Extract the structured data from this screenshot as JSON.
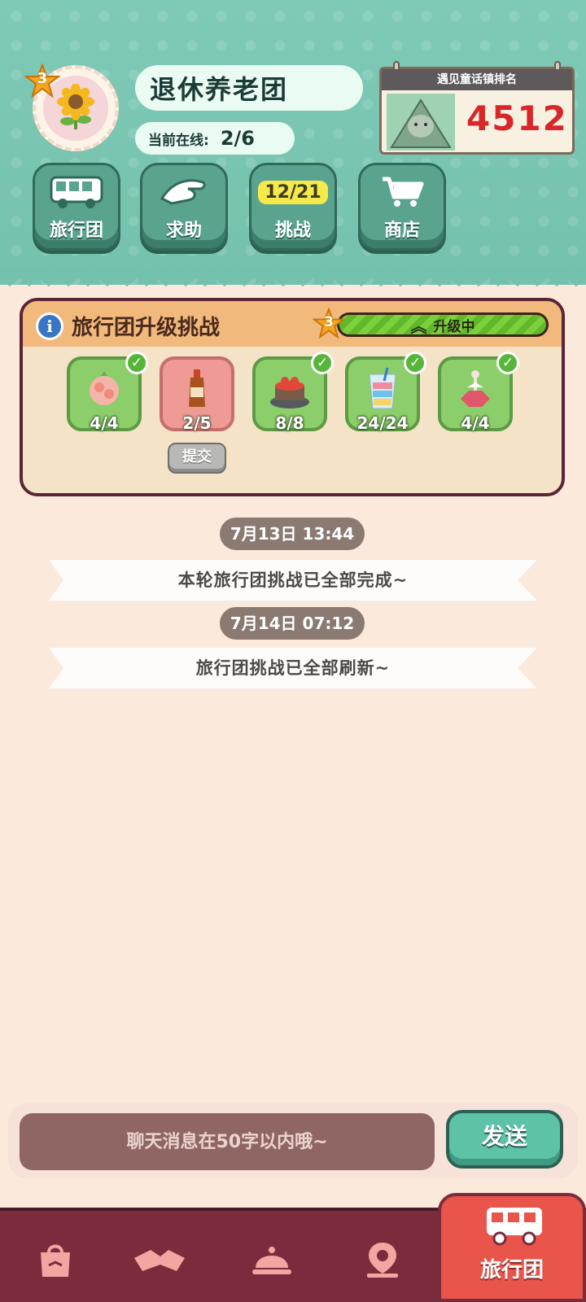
{
  "header": {
    "level": "3",
    "group_name": "退休养老团",
    "online_label": "当前在线:",
    "online_value": "2/6",
    "rank_title": "遇见童话镇排名",
    "rank_value": "4512"
  },
  "nav": [
    {
      "label": "旅行团",
      "icon": "bus-icon"
    },
    {
      "label": "求助",
      "icon": "hand-icon"
    },
    {
      "label": "挑战",
      "badge": "12/21"
    },
    {
      "label": "商店",
      "icon": "cart-icon"
    }
  ],
  "challenge": {
    "title": "旅行团升级挑战",
    "level": "3",
    "status": "升级中",
    "items": [
      {
        "name": "pink-candy",
        "count": "4/4",
        "done": true
      },
      {
        "name": "sauce-bottle",
        "count": "2/5",
        "done": false
      },
      {
        "name": "strawberry-cake",
        "count": "8/8",
        "done": true
      },
      {
        "name": "parfait-cup",
        "count": "24/24",
        "done": true
      },
      {
        "name": "dancer-cake",
        "count": "4/4",
        "done": true
      }
    ],
    "submit_label": "提交"
  },
  "messages": [
    {
      "time": "7月13日  13:44",
      "text": "本轮旅行团挑战已全部完成~"
    },
    {
      "time": "7月14日  07:12",
      "text": "旅行团挑战已全部刷新~"
    }
  ],
  "chat": {
    "placeholder": "聊天消息在50字以内哦~",
    "send_label": "发送"
  },
  "bottom_nav": {
    "active_label": "旅行团"
  },
  "colors": {
    "teal": "#74c1ae",
    "panel_border": "#5a2536",
    "accent_red": "#e9554a"
  }
}
